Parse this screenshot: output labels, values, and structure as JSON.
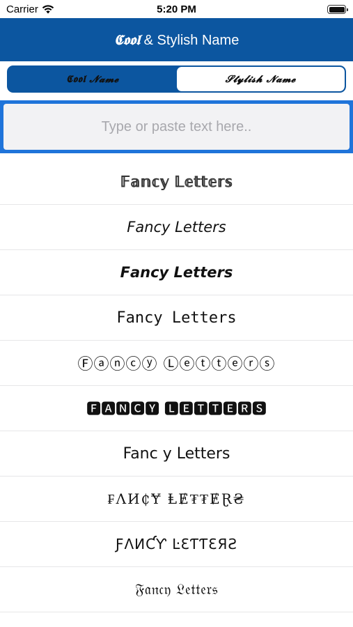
{
  "status_bar": {
    "carrier": "Carrier",
    "time": "5:20 PM",
    "wifi_icon": "wifi-icon",
    "battery_icon": "battery-icon"
  },
  "nav": {
    "title_fancy": "𝕮𝖔𝖔𝖑",
    "title_rest": " & Stylish Name",
    "color": "#0c56a0"
  },
  "segments": [
    {
      "label": "𝕮𝖔𝖔𝖑 𝓝𝓪𝓶𝓮",
      "active": true
    },
    {
      "label": "𝓢𝓽𝔂𝓵𝓲𝓼𝓱 𝓝𝓪𝓶𝓮",
      "active": false
    }
  ],
  "input": {
    "placeholder": "Type or paste text here..",
    "value": "",
    "border_color": "#1f74da"
  },
  "styles": [
    "𝔽𝕒𝕟𝕔𝕪 𝕃𝕖𝕥𝕥𝕖𝕣𝕤",
    "𝘍𝘢𝘯𝘤𝘺 𝘓𝘦𝘵𝘵𝘦𝘳𝘴",
    "𝙁𝙖𝙣𝙘𝙮 𝙇𝙚𝙩𝙩𝙚𝙧𝙨",
    "𝙵𝚊𝚗𝚌𝚢 𝙻𝚎𝚝𝚝𝚎𝚛𝚜",
    "Ⓕⓐⓝⓒⓨ Ⓛⓔⓣⓣⓔⓡⓢ",
    "🅵🅰🅽🅲🆈 🅻🅴🆃🆃🅴🆁🆂",
    "Fanc y Letters",
    "₣ΛИ₵Ɏ ⱠɆ₮₮ɆⱤ₴",
    "ƑΛИƇƳ ĿƐƬƬƐЯƧ",
    "𝔉𝔞𝔫𝔠𝔶 𝔏𝔢𝔱𝔱𝔢𝔯𝔰"
  ]
}
